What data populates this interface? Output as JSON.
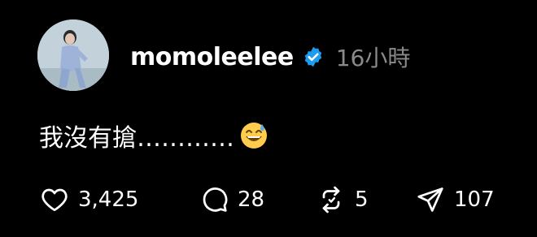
{
  "post": {
    "username": "momoleelee",
    "timestamp": "16小時",
    "text": "我沒有搶…………",
    "emoji_icon": "grinning-sweat-emoji-icon"
  },
  "actions": {
    "like_count": "3,425",
    "comment_count": "28",
    "repost_count": "5",
    "share_count": "107"
  },
  "colors": {
    "background": "#000000",
    "text": "#ffffff",
    "muted": "#8a8a8a",
    "verified": "#1d9bf0"
  }
}
